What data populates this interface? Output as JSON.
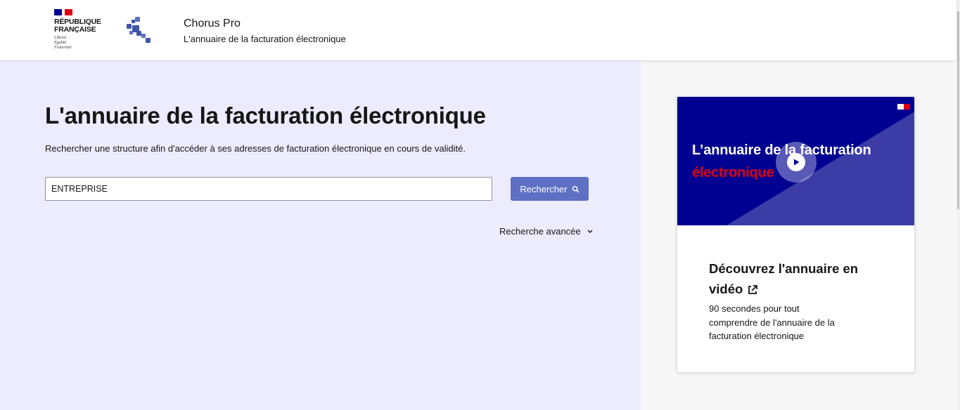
{
  "header": {
    "gov_logo_text": "RÉPUBLIQUE FRANÇAISE",
    "gov_motto": [
      "Liberté",
      "Égalité",
      "Fraternité"
    ],
    "app_title": "Chorus Pro",
    "app_subtitle": "L'annuaire de la facturation électronique"
  },
  "main": {
    "title": "L'annuaire de la facturation électronique",
    "lead": "Rechercher une structure afin d'accéder à ses adresses de facturation électronique en cours de validité.",
    "search_value": "ENTREPRISE",
    "search_button": "Rechercher",
    "advanced_search": "Recherche avancée"
  },
  "card": {
    "video_title_line1": "L’annuaire de la facturation",
    "video_title_line2": "électronique",
    "title": "Découvrez l'annuaire en vidéo",
    "description": "90 secondes pour tout comprendre de l'annuaire de la facturation électronique"
  },
  "colors": {
    "accent": "#000091",
    "button": "#5e70c4",
    "red": "#e1000f",
    "left_bg": "#ececfe",
    "right_bg": "#f6f6f6"
  },
  "icons": {
    "search": "search-icon",
    "chevron": "chevron-down-icon",
    "external": "external-link-icon",
    "play": "play-icon"
  }
}
